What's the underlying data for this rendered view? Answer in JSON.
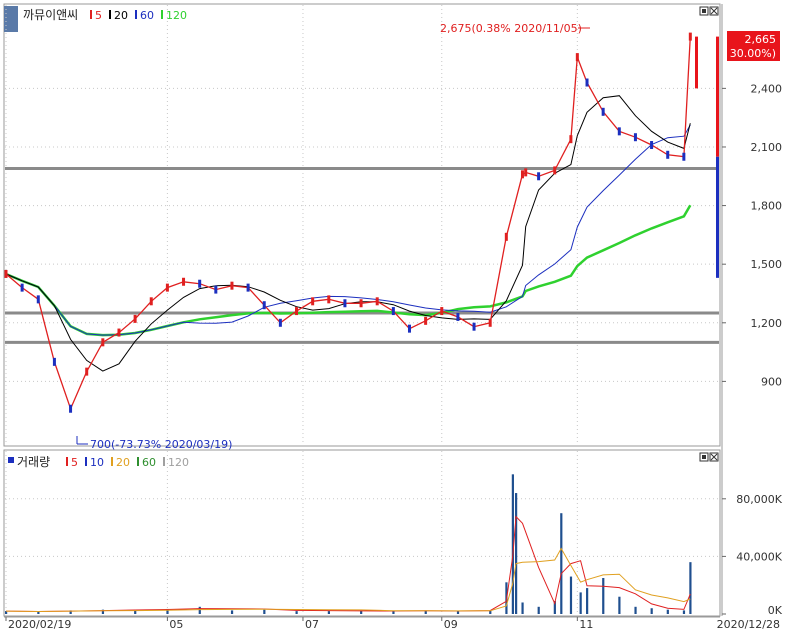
{
  "price_panel": {
    "title": "까뮤이앤씨",
    "ma_legend": [
      {
        "label": "5",
        "color": "#e02020"
      },
      {
        "label": "20",
        "color": "#000000"
      },
      {
        "label": "60",
        "color": "#1c2fbf"
      },
      {
        "label": "120",
        "color": "#2fd12f"
      }
    ],
    "high_annotation": "2,675(0.38% 2020/11/05)",
    "low_annotation": "700(-73.73% 2020/03/19)",
    "last_price_badge": {
      "price": "2,665",
      "change": "( 30.00%)",
      "color": "#e8141b"
    },
    "y_ticks": [
      {
        "value": 900,
        "label": "900"
      },
      {
        "value": 1200,
        "label": "1,200"
      },
      {
        "value": 1500,
        "label": "1,500"
      },
      {
        "value": 1800,
        "label": "1,800"
      },
      {
        "value": 2100,
        "label": "2,100"
      },
      {
        "value": 2400,
        "label": "2,400"
      }
    ],
    "horizontal_lines": [
      1100,
      1250,
      1990
    ]
  },
  "volume_panel": {
    "title": "거래량",
    "legend": [
      {
        "label": "5",
        "color": "#e02020"
      },
      {
        "label": "10",
        "color": "#1c2fbf"
      },
      {
        "label": "20",
        "color": "#e0a020"
      },
      {
        "label": "60",
        "color": "#2f8f2f"
      },
      {
        "label": "120",
        "color": "#a0a0a0"
      }
    ],
    "y_ticks": [
      {
        "value": 0,
        "label": "0K"
      },
      {
        "value": 40000,
        "label": "40,000K"
      },
      {
        "value": 80000,
        "label": "80,000K"
      }
    ]
  },
  "x_axis": {
    "ticks": [
      {
        "label": "2020/02/19",
        "index": 0
      },
      {
        "label": "05",
        "index": 50
      },
      {
        "label": "07",
        "index": 92
      },
      {
        "label": "09",
        "index": 135
      },
      {
        "label": "11",
        "index": 177
      }
    ],
    "end_label": "2020/12/28"
  },
  "chart_data": {
    "type": "line",
    "title": "",
    "x_range": [
      "2020/02/19",
      "2020/12/28"
    ],
    "price_ylim": [
      600,
      2750
    ],
    "volume_ylim": [
      0,
      100000
    ],
    "marked_points": [
      {
        "date": "2020/03/19",
        "price": 700,
        "label": "low"
      },
      {
        "date": "2020/11/05",
        "price": 2675,
        "label": "high"
      },
      {
        "date": "2020/12/28",
        "price": 2665,
        "label": "last"
      }
    ],
    "series": [
      {
        "name": "까뮤이앤씨",
        "x": [
          0,
          5,
          10,
          15,
          20,
          25,
          30,
          35,
          40,
          45,
          50,
          55,
          60,
          65,
          70,
          75,
          80,
          85,
          90,
          95,
          100,
          105,
          110,
          115,
          120,
          125,
          130,
          135,
          140,
          145,
          150,
          155,
          160,
          161,
          165,
          170,
          175,
          177,
          180,
          185,
          190,
          195,
          200,
          205,
          210,
          212
        ],
        "values": [
          1450,
          1380,
          1320,
          1000,
          760,
          950,
          1100,
          1150,
          1220,
          1310,
          1380,
          1410,
          1400,
          1370,
          1390,
          1380,
          1290,
          1200,
          1260,
          1310,
          1320,
          1300,
          1300,
          1310,
          1260,
          1170,
          1210,
          1260,
          1230,
          1180,
          1200,
          1640,
          1960,
          1970,
          1950,
          1980,
          2140,
          2560,
          2430,
          2280,
          2180,
          2150,
          2110,
          2060,
          2050,
          2665
        ]
      }
    ],
    "volume": {
      "x": [
        0,
        10,
        20,
        30,
        40,
        50,
        60,
        70,
        80,
        90,
        100,
        110,
        120,
        130,
        140,
        150,
        155,
        157,
        158,
        160,
        165,
        170,
        172,
        175,
        178,
        180,
        185,
        190,
        195,
        200,
        205,
        210,
        212
      ],
      "values": [
        2000,
        1500,
        2500,
        3000,
        2800,
        3500,
        5000,
        2500,
        3000,
        2000,
        2000,
        2500,
        1800,
        2500,
        2000,
        2500,
        22000,
        97000,
        84000,
        8000,
        5000,
        9000,
        70000,
        26000,
        15000,
        18000,
        25000,
        12000,
        5000,
        4000,
        3000,
        2500,
        36000
      ]
    }
  }
}
